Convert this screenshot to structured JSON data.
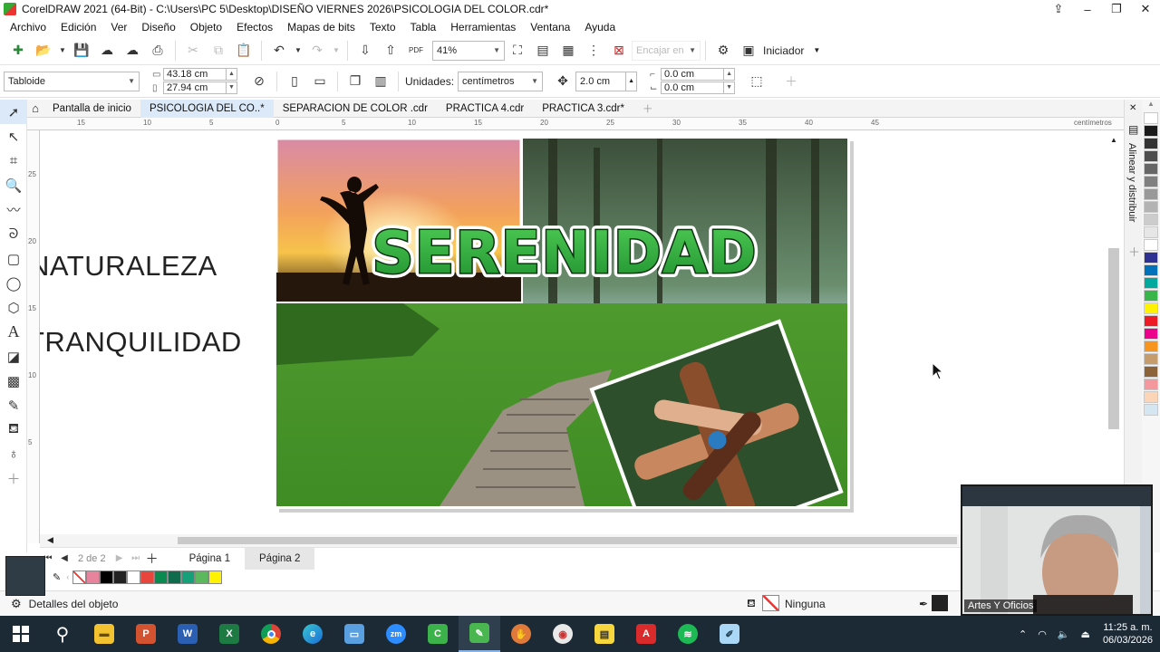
{
  "window": {
    "title": "CorelDRAW 2021 (64-Bit) - C:\\Users\\PC 5\\Desktop\\DISEÑO VIERNES 2026\\PSICOLOGIA DEL COLOR.cdr*",
    "minimize": "–",
    "maximize": "❐",
    "close": "✕"
  },
  "menu": [
    "Archivo",
    "Edición",
    "Ver",
    "Diseño",
    "Objeto",
    "Efectos",
    "Mapas de bits",
    "Texto",
    "Tabla",
    "Herramientas",
    "Ventana",
    "Ayuda"
  ],
  "standard_toolbar": {
    "zoom": "41%",
    "snap_to": "Encajar en",
    "launcher": "Iniciador"
  },
  "property_bar": {
    "page_size": "Tabloide",
    "width": "43.18 cm",
    "height": "27.94 cm",
    "units_label": "Unidades:",
    "units": "centímetros",
    "nudge": "2.0 cm",
    "dup_x": "0.0 cm",
    "dup_y": "0.0 cm"
  },
  "document_tabs": [
    {
      "label": "Pantalla de inicio",
      "active": false
    },
    {
      "label": "PSICOLOGIA DEL CO..*",
      "active": true
    },
    {
      "label": "SEPARACION DE COLOR .cdr",
      "active": false
    },
    {
      "label": "PRACTICA 4.cdr",
      "active": false
    },
    {
      "label": "PRACTICA 3.cdr*",
      "active": false
    }
  ],
  "ruler": {
    "h_ticks": [
      "15",
      "10",
      "5",
      "0",
      "5",
      "10",
      "15",
      "20",
      "25",
      "30",
      "35",
      "40",
      "45"
    ],
    "v_ticks": [
      "25",
      "20",
      "15",
      "10",
      "5"
    ],
    "unit": "centímetros"
  },
  "canvas": {
    "text_items": [
      "NATURALEZA",
      "TRANQUILIDAD"
    ],
    "collage_title": "SERENIDAD"
  },
  "right_docker": {
    "title": "Alinear y distribuir"
  },
  "color_palette": [
    "#ffffff",
    "#1a1a1a",
    "#333333",
    "#4d4d4d",
    "#666666",
    "#808080",
    "#999999",
    "#b3b3b3",
    "#cccccc",
    "#e6e6e6",
    "#ffffff",
    "#2e3192",
    "#0072bc",
    "#00a99d",
    "#39b54a",
    "#fff200",
    "#ed1c24",
    "#ec008c",
    "#f7941d",
    "#c69c6d",
    "#8c6239",
    "#f5989d",
    "#fbd5b5",
    "#d4e6f1"
  ],
  "page_navigator": {
    "count": "2 de 2",
    "pages": [
      {
        "label": "Página 1",
        "active": false
      },
      {
        "label": "Página 2",
        "active": true
      }
    ]
  },
  "document_palette": [
    "#e7839c",
    "#000000",
    "#222222",
    "#ffffff",
    "#e8453c",
    "#0b8a4f",
    "#0f6b4b",
    "#15a07a",
    "#5cb85c",
    "#fff200"
  ],
  "status": {
    "object_details": "Detalles del objeto",
    "fill": "Ninguna"
  },
  "webcam": {
    "caption": "Artes Y Oficios"
  },
  "taskbar": {
    "apps": [
      "explorer",
      "powerpoint",
      "word",
      "excel",
      "chrome",
      "edge",
      "remote-desktop",
      "zoom",
      "corel-store",
      "coreldraw",
      "game",
      "photo-paint",
      "sticky-notes",
      "acrobat",
      "spotify",
      "notepad"
    ],
    "time": "11:25 a. m.",
    "date": "06/03/2026"
  }
}
